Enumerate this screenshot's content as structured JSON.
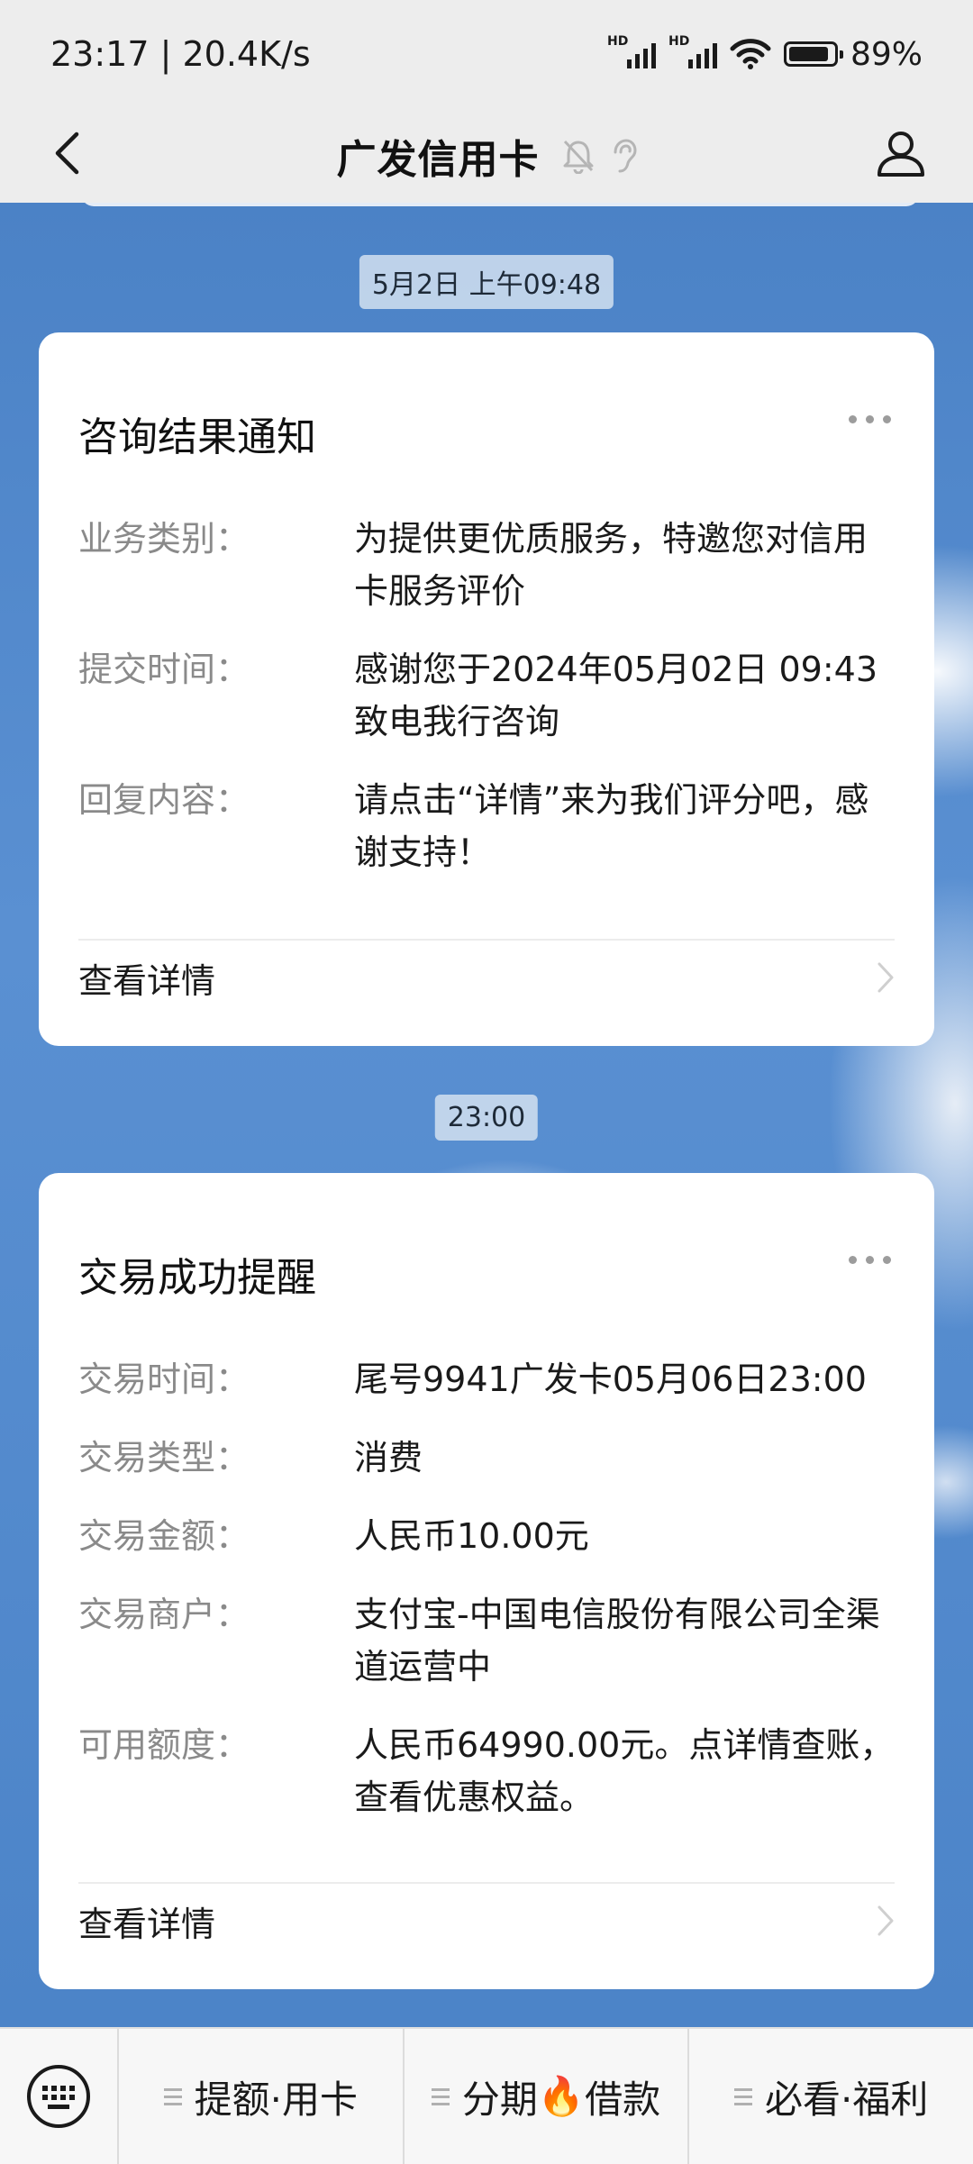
{
  "status": {
    "time": "23:17",
    "speed": "20.4K/s",
    "battery": "89%",
    "battery_level": 0.89,
    "hd1": "HD",
    "hd2": "HD"
  },
  "nav": {
    "title": "广发信用卡"
  },
  "chat": {
    "ts1": "5月2日 上午09:48",
    "ts2": "23:00",
    "card1": {
      "title": "咨询结果通知",
      "rows": [
        {
          "label": "业务类别：",
          "value": "为提供更优质服务，特邀您对信用卡服务评价"
        },
        {
          "label": "提交时间：",
          "value": "感谢您于2024年05月02日 09:43致电我行咨询"
        },
        {
          "label": "回复内容：",
          "value": "请点击“详情”来为我们评分吧，感谢支持！"
        }
      ],
      "detail": "查看详情"
    },
    "card2": {
      "title": "交易成功提醒",
      "rows": [
        {
          "label": "交易时间：",
          "value": "尾号9941广发卡05月06日23:00"
        },
        {
          "label": "交易类型：",
          "value": "消费"
        },
        {
          "label": "交易金额：",
          "value": "人民币10.00元"
        },
        {
          "label": "交易商户：",
          "value": "支付宝-中国电信股份有限公司全渠道运营中"
        },
        {
          "label": "可用额度：",
          "value": "人民币64990.00元。点详情查账，查看优惠权益。"
        }
      ],
      "detail": "查看详情"
    }
  },
  "menu": {
    "item1": "提额·用卡",
    "item2_a": "分期",
    "item2_emoji": "🔥",
    "item2_b": "借款",
    "item3": "必看·福利"
  }
}
